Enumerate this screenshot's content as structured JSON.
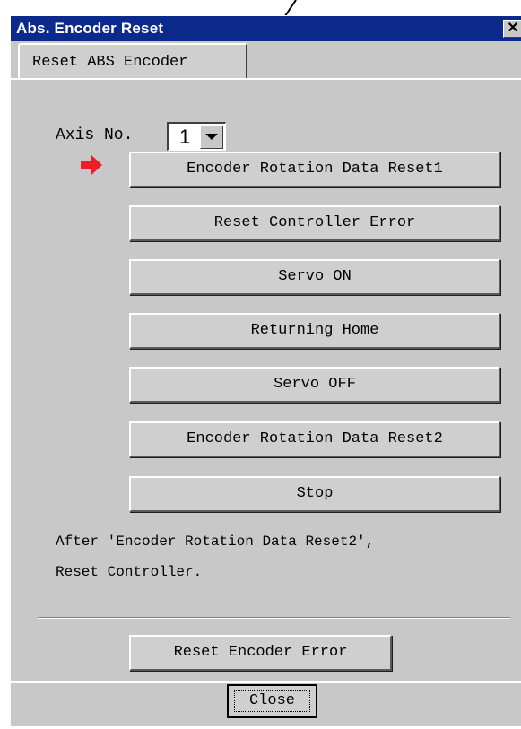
{
  "window": {
    "title": "Abs. Encoder Reset",
    "close_glyph": "✕",
    "title_bar_color": "#0c2a8c",
    "face_color": "#c8c8c8"
  },
  "tab": {
    "label": "Reset ABS Encoder"
  },
  "axis": {
    "label": "Axis No.",
    "value": "1",
    "dropdown_icon": "chevron-down-icon"
  },
  "marker": {
    "icon": "arrow-right-icon",
    "color": "#e8202a"
  },
  "steps": [
    "Encoder Rotation Data Reset1",
    "Reset Controller Error",
    "Servo ON",
    "Returning Home",
    "Servo OFF",
    "Encoder Rotation Data Reset2",
    "Stop"
  ],
  "note": {
    "line1": "After 'Encoder Rotation Data Reset2',",
    "line2": "Reset Controller."
  },
  "reset_encoder_error": "Reset Encoder Error",
  "close_button": "Close"
}
